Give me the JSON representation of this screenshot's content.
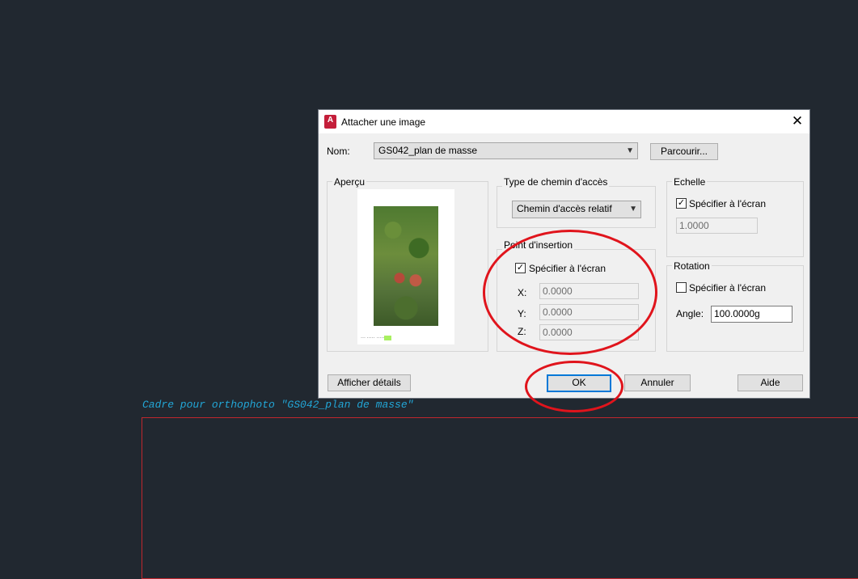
{
  "canvas": {
    "label": "Cadre pour orthophoto \"GS042_plan de masse\"",
    "frame_color": "#c0272d",
    "label_color": "#22a6d6"
  },
  "dialog": {
    "title": "Attacher une image",
    "icon": "autocad-icon",
    "name_label": "Nom:",
    "name_value": "GS042_plan de masse",
    "browse_label": "Parcourir...",
    "preview": {
      "title": "Aperçu",
      "caption": "··· ·····  ·····"
    },
    "path_type": {
      "title": "Type de chemin d'accès",
      "value": "Chemin d'accès relatif"
    },
    "insertion": {
      "title": "Point d'insertion",
      "specify_label": "Spécifier à l'écran",
      "specify_checked": true,
      "x_label": "X:",
      "x_value": "0.0000",
      "y_label": "Y:",
      "y_value": "0.0000",
      "z_label": "Z:",
      "z_value": "0.0000"
    },
    "scale": {
      "title": "Echelle",
      "specify_label": "Spécifier à l'écran",
      "specify_checked": true,
      "value": "1.0000"
    },
    "rotation": {
      "title": "Rotation",
      "specify_label": "Spécifier à l'écran",
      "specify_checked": false,
      "angle_label": "Angle:",
      "angle_value": "100.0000g"
    },
    "details_label": "Afficher détails",
    "ok_label": "OK",
    "cancel_label": "Annuler",
    "help_label": "Aide"
  },
  "annotation_color": "#e0141c"
}
